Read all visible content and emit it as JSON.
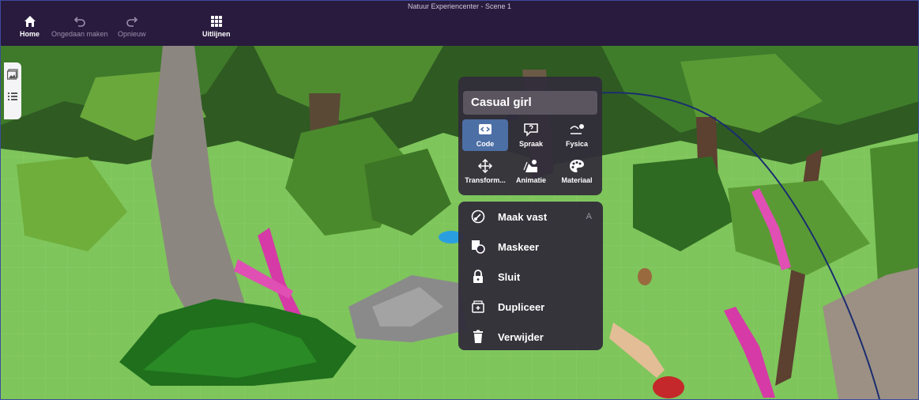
{
  "window": {
    "title": "Natuur Experiencenter - Scene 1"
  },
  "toolbar": {
    "home_label": "Home",
    "undo_label": "Ongedaan maken",
    "redo_label": "Opnieuw",
    "align_label": "Uitlijnen"
  },
  "side_rail": {
    "items": [
      "gallery-icon",
      "list-icon"
    ]
  },
  "object_panel": {
    "name": "Casual girl",
    "tools": [
      {
        "label": "Code",
        "icon": "code-icon",
        "selected": true
      },
      {
        "label": "Spraak",
        "icon": "speech-bubble-icon",
        "selected": false
      },
      {
        "label": "Fysica",
        "icon": "physics-icon",
        "selected": false
      },
      {
        "label": "Transform...",
        "icon": "move-icon",
        "selected": false
      },
      {
        "label": "Animatie",
        "icon": "animation-icon",
        "selected": false
      },
      {
        "label": "Materiaal",
        "icon": "palette-icon",
        "selected": false
      }
    ]
  },
  "context_menu": {
    "items": [
      {
        "label": "Maak vast",
        "icon": "attach-icon",
        "hotkey": "A"
      },
      {
        "label": "Maskeer",
        "icon": "mask-icon",
        "hotkey": ""
      },
      {
        "label": "Sluit",
        "icon": "lock-icon",
        "hotkey": ""
      },
      {
        "label": "Dupliceer",
        "icon": "duplicate-icon",
        "hotkey": ""
      },
      {
        "label": "Verwijder",
        "icon": "trash-icon",
        "hotkey": ""
      }
    ]
  },
  "colors": {
    "topbar": "#291b3e",
    "panel": "#322c3a",
    "selected_tool": "#4c6fa5",
    "grass": "#7cbf5a",
    "arrow": "#1a2e6e"
  }
}
